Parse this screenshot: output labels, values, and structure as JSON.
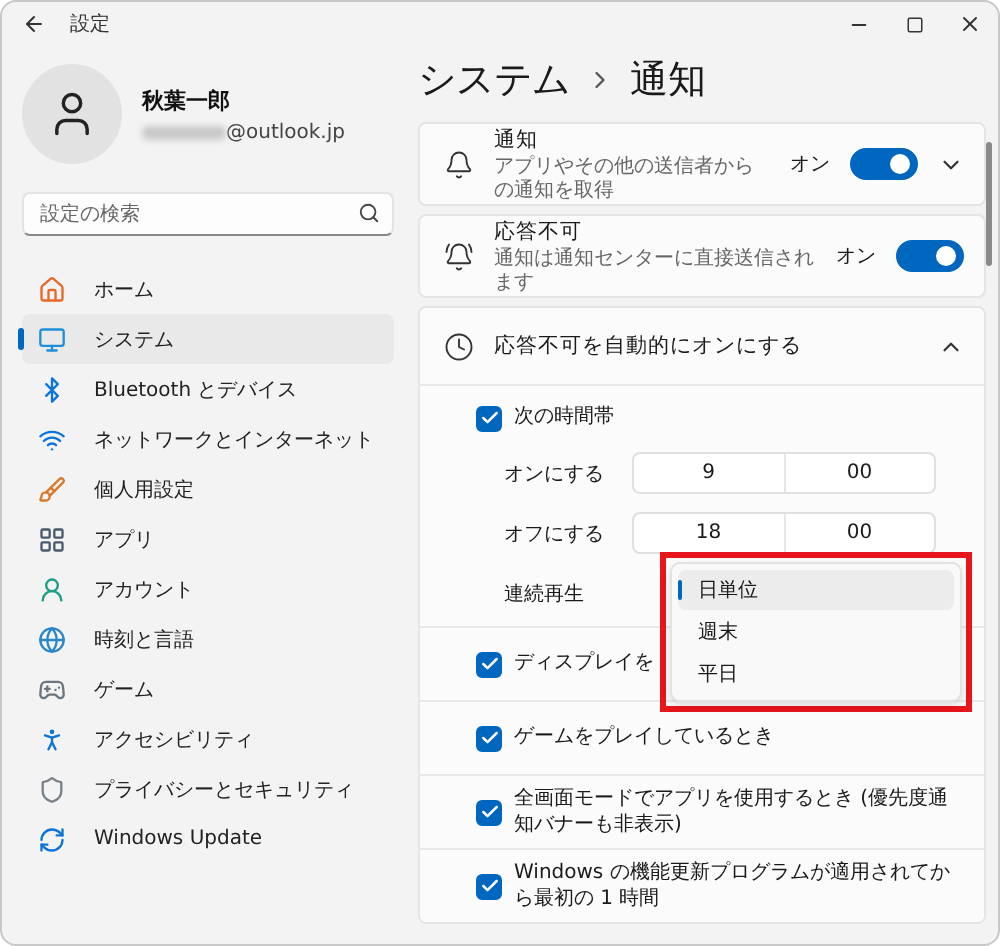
{
  "window": {
    "title": "設定"
  },
  "profile": {
    "name": "秋葉一郎",
    "email": "@outlook.jp"
  },
  "search": {
    "placeholder": "設定の検索"
  },
  "nav": [
    {
      "label": "ホーム",
      "selected": false
    },
    {
      "label": "システム",
      "selected": true
    },
    {
      "label": "Bluetooth とデバイス",
      "selected": false
    },
    {
      "label": "ネットワークとインターネット",
      "selected": false
    },
    {
      "label": "個人用設定",
      "selected": false
    },
    {
      "label": "アプリ",
      "selected": false
    },
    {
      "label": "アカウント",
      "selected": false
    },
    {
      "label": "時刻と言語",
      "selected": false
    },
    {
      "label": "ゲーム",
      "selected": false
    },
    {
      "label": "アクセシビリティ",
      "selected": false
    },
    {
      "label": "プライバシーとセキュリティ",
      "selected": false
    },
    {
      "label": "Windows Update",
      "selected": false
    }
  ],
  "breadcrumb": {
    "parent": "システム",
    "current": "通知"
  },
  "settings": [
    {
      "kind": "toggle",
      "title": "通知",
      "subtitle": "アプリやその他の送信者からの通知を取得",
      "state_label": "オン",
      "on": true,
      "expandable": true
    },
    {
      "kind": "toggle",
      "title": "応答不可",
      "subtitle": "通知は通知センターに直接送信されます",
      "state_label": "オン",
      "on": true,
      "expandable": false
    },
    {
      "kind": "expander",
      "title": "応答不可を自動的にオンにする",
      "expanded": true
    }
  ],
  "schedule": {
    "checkbox": {
      "label": "次の時間帯",
      "checked": true
    },
    "times": [
      {
        "label": "オンにする",
        "hour": "9",
        "minute": "00"
      },
      {
        "label": "オフにする",
        "hour": "18",
        "minute": "00"
      }
    ],
    "repeat_label": "連続再生",
    "repeat_menu": {
      "highlighted": true,
      "options": [
        {
          "label": "日単位",
          "selected": true
        },
        {
          "label": "週末",
          "selected": false
        },
        {
          "label": "平日",
          "selected": false
        }
      ]
    }
  },
  "conditions": [
    {
      "label": "ディスプレイを",
      "checked": true
    },
    {
      "label": "ゲームをプレイしているとき",
      "checked": true
    },
    {
      "label": "全画面モードでアプリを使用するとき (優先度通知バナーも非表示)",
      "checked": true
    },
    {
      "label": "Windows の機能更新プログラムが適用されてから最初の 1 時間",
      "checked": true
    }
  ]
}
